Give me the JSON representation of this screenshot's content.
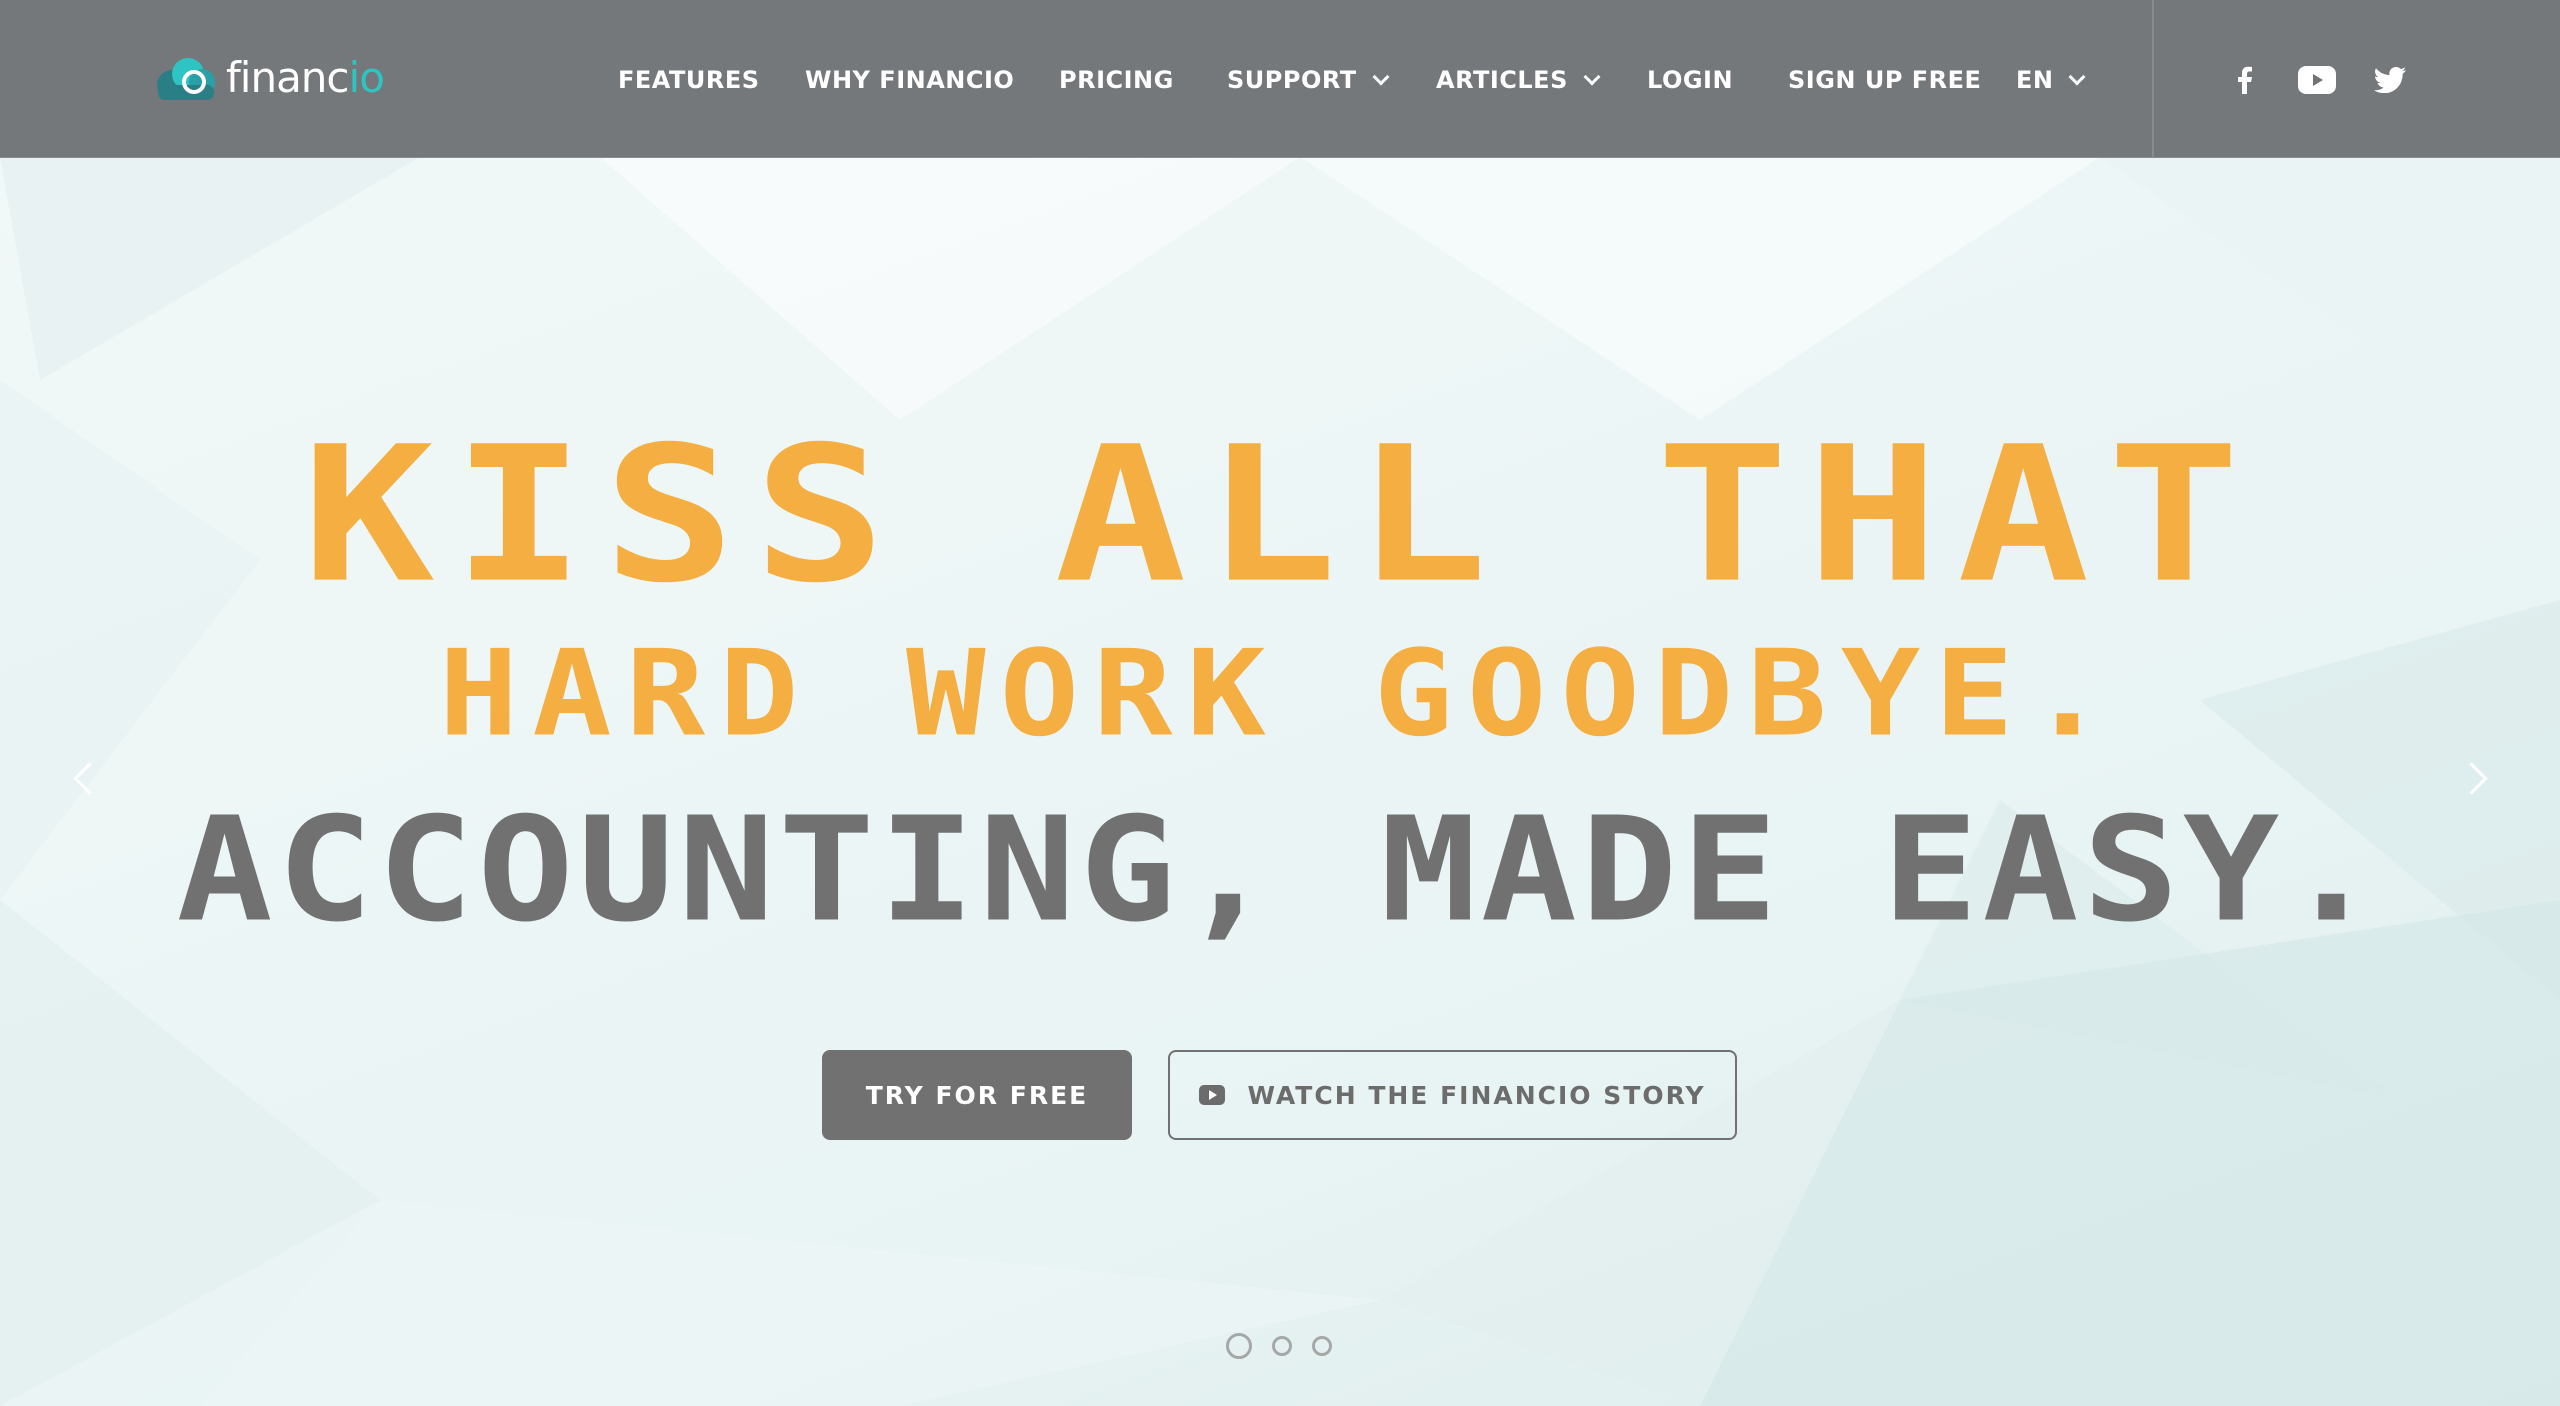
{
  "colors": {
    "header_bg": "#707476",
    "accent_orange": "#f4ae42",
    "text_gray": "#717171",
    "logo_accent": "#2ec4c4"
  },
  "header": {
    "logo": {
      "text_main": "financ",
      "text_accent": "io"
    },
    "nav": [
      {
        "label": "FEATURES",
        "dropdown": false
      },
      {
        "label": "WHY FINANCIO",
        "dropdown": false
      },
      {
        "label": "PRICING",
        "dropdown": false
      },
      {
        "label": "SUPPORT",
        "dropdown": true
      },
      {
        "label": "ARTICLES",
        "dropdown": true
      },
      {
        "label": "LOGIN",
        "dropdown": false
      },
      {
        "label": "SIGN UP FREE",
        "dropdown": false
      },
      {
        "label": "EN",
        "dropdown": true
      }
    ],
    "social": [
      "facebook-icon",
      "youtube-icon",
      "twitter-icon"
    ]
  },
  "hero": {
    "line1": "KISS ALL THAT",
    "line2": "HARD WORK GOODBYE.",
    "line3": "ACCOUNTING, MADE EASY.",
    "primary_button": "TRY FOR FREE",
    "secondary_button": "WATCH THE FINANCIO STORY",
    "secondary_icon": "play-icon"
  },
  "carousel": {
    "slides": 3,
    "active_slide": 1
  }
}
